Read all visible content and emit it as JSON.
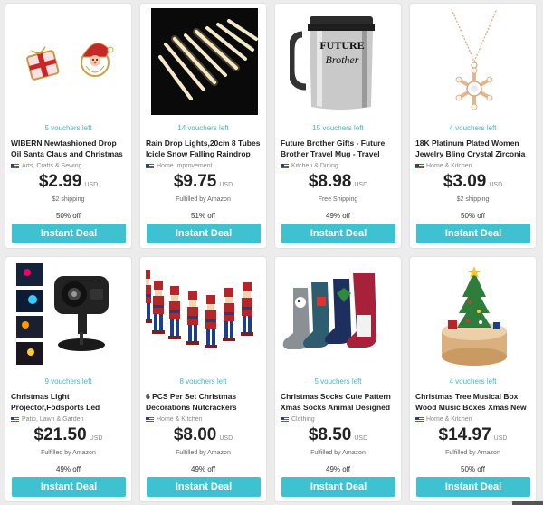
{
  "deals": [
    {
      "vouchers": "5 vouchers left",
      "title": "WIBERN Newfashioned Drop Oil Santa Claus and Christmas",
      "category": "Arts, Crafts & Sewing",
      "price": "$2.99",
      "currency": "USD",
      "shipping": "$2 shipping",
      "discount": "50% off",
      "button": "Instant Deal",
      "icon": "santa-gift-earrings-icon"
    },
    {
      "vouchers": "14 vouchers left",
      "title": "Rain Drop Lights,20cm 8 Tubes Icicle Snow Falling Raindrop",
      "category": "Home Improvement",
      "price": "$9.75",
      "currency": "USD",
      "shipping": "Fulfilled by Amazon",
      "discount": "51% off",
      "button": "Instant Deal",
      "icon": "raindrop-lights-icon"
    },
    {
      "vouchers": "15 vouchers left",
      "title": "Future Brother Gifts - Future Brother Travel Mug - Travel",
      "category": "Kitchen & Dining",
      "price": "$8.98",
      "currency": "USD",
      "shipping": "Free Shipping",
      "discount": "49% off",
      "button": "Instant Deal",
      "icon": "travel-mug-icon",
      "mug_text": [
        "FUTURE",
        "Brother"
      ]
    },
    {
      "vouchers": "4 vouchers left",
      "title": "18K Platinum Plated Women Jewelry Bling Crystal Zirconia",
      "category": "Home & Kitchen",
      "price": "$3.09",
      "currency": "USD",
      "shipping": "$2 shipping",
      "discount": "50% off",
      "button": "Instant Deal",
      "icon": "snowflake-necklace-icon"
    },
    {
      "vouchers": "9 vouchers left",
      "title": "Christmas Light Projector,Fodsports Led",
      "category": "Patio, Lawn & Garden",
      "price": "$21.50",
      "currency": "USD",
      "shipping": "Fulfilled by Amazon",
      "discount": "49% off",
      "button": "Instant Deal",
      "icon": "light-projector-icon"
    },
    {
      "vouchers": "8 vouchers left",
      "title": "6 PCS Per Set Christmas Decorations Nutcrackers",
      "category": "Home & Kitchen",
      "price": "$8.00",
      "currency": "USD",
      "shipping": "Fulfilled by Amazon",
      "discount": "49% off",
      "button": "Instant Deal",
      "icon": "nutcrackers-icon"
    },
    {
      "vouchers": "5 vouchers left",
      "title": "Christmas Socks Cute Pattern Xmas Socks Animal Designed",
      "category": "Clothing",
      "price": "$8.50",
      "currency": "USD",
      "shipping": "Fulfilled by Amazon",
      "discount": "49% off",
      "button": "Instant Deal",
      "icon": "christmas-socks-icon"
    },
    {
      "vouchers": "4 vouchers left",
      "title": "Christmas Tree Musical Box Wood Music Boxes Xmas New",
      "category": "Home & Kitchen",
      "price": "$14.97",
      "currency": "USD",
      "shipping": "Fulfilled by Amazon",
      "discount": "50% off",
      "button": "Instant Deal",
      "icon": "music-box-icon"
    }
  ],
  "colors": {
    "accent": "#3ec2cf",
    "voucher_text": "#3db9c6",
    "background": "#ececec"
  }
}
